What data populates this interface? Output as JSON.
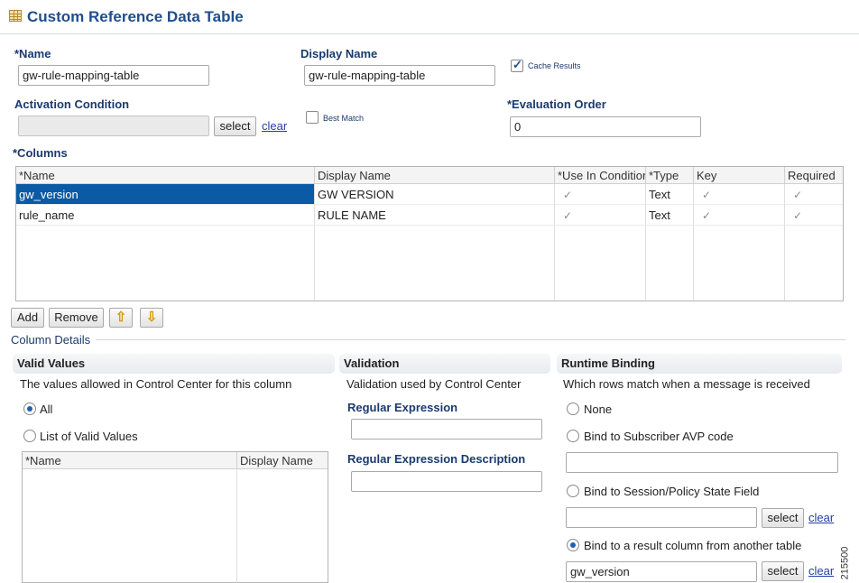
{
  "header": {
    "title": "Custom Reference Data Table"
  },
  "form": {
    "name_label": "*Name",
    "name_value": "gw-rule-mapping-table",
    "display_name_label": "Display Name",
    "display_name_value": "gw-rule-mapping-table",
    "cache_results_label": "Cache Results",
    "cache_results_checked": true,
    "activation_label": "Activation Condition",
    "activation_value": "",
    "select_label": "select",
    "clear_label": "clear",
    "best_match_label": "Best Match",
    "best_match_checked": false,
    "eval_order_label": "*Evaluation Order",
    "eval_order_value": "0"
  },
  "columns": {
    "label": "*Columns",
    "headers": [
      "*Name",
      "Display Name",
      "*Use In Conditions",
      "*Type",
      "Key",
      "Required"
    ],
    "rows": [
      {
        "name": "gw_version",
        "display": "GW VERSION",
        "use": "✓",
        "type": "Text",
        "key": "✓",
        "required": "✓"
      },
      {
        "name": "rule_name",
        "display": "RULE NAME",
        "use": "✓",
        "type": "Text",
        "key": "✓",
        "required": "✓"
      }
    ],
    "add_label": "Add",
    "remove_label": "Remove",
    "up_icon": "arrow-up-icon",
    "down_icon": "arrow-down-icon"
  },
  "column_details": {
    "label": "Column Details"
  },
  "valid_values": {
    "title": "Valid Values",
    "desc": "The values allowed in Control Center for this column",
    "all_label": "All",
    "list_label": "List of Valid Values",
    "selected": "All",
    "headers": [
      "*Name",
      "Display Name"
    ]
  },
  "validation": {
    "title": "Validation",
    "desc": "Validation used by Control Center",
    "regex_label": "Regular Expression",
    "regex_value": "",
    "regex_desc_label": "Regular Expression Description",
    "regex_desc_value": ""
  },
  "runtime": {
    "title": "Runtime Binding",
    "desc": "Which rows match when a message is received",
    "none_label": "None",
    "avp_label": "Bind to Subscriber AVP code",
    "avp_value": "",
    "session_label": "Bind to Session/Policy State Field",
    "session_value": "",
    "result_label": "Bind to a result column from another table",
    "result_value": "gw_version",
    "selected": "result",
    "select_label": "select",
    "clear_label": "clear"
  },
  "figure_number": "215500",
  "colors": {
    "accent": "#1f4e8c",
    "selection": "#0b5aa6",
    "link": "#1f3fa8"
  }
}
